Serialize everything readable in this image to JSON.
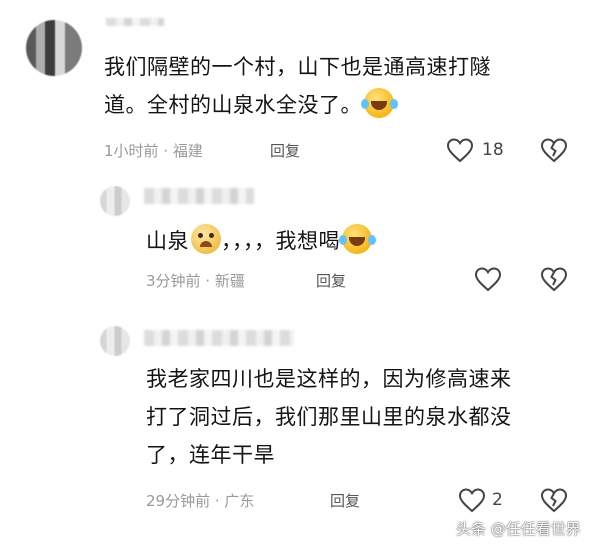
{
  "comments": [
    {
      "text_lines": [
        "我们隔壁的一个村，山下也是通高速打隧",
        "道。全村的山泉水全没了。"
      ],
      "emoji": "face-with-tears-of-joy",
      "meta": "1小时前 · 福建",
      "reply_label": "回复",
      "likes": "18"
    },
    {
      "text_parts": [
        "山泉",
        "，，，，我想喝"
      ],
      "emoji_inline": "pleading-face",
      "emoji": "face-with-tears-of-joy",
      "meta": "3分钟前 · 新疆",
      "reply_label": "回复",
      "likes": ""
    },
    {
      "text_lines": [
        "我老家四川也是这样的，因为修高速来",
        "打了洞过后，我们那里山里的泉水都没",
        "了，连年干旱"
      ],
      "meta": "29分钟前 · 广东",
      "reply_label": "回复",
      "likes": "2"
    }
  ],
  "watermark": {
    "platform": "头条",
    "handle": "@任任看世界"
  },
  "icons": {
    "like": "heart-outline-icon",
    "dislike": "broken-heart-outline-icon"
  },
  "colors": {
    "text": "#141414",
    "meta": "#9a9a9a",
    "icon": "#444444"
  }
}
